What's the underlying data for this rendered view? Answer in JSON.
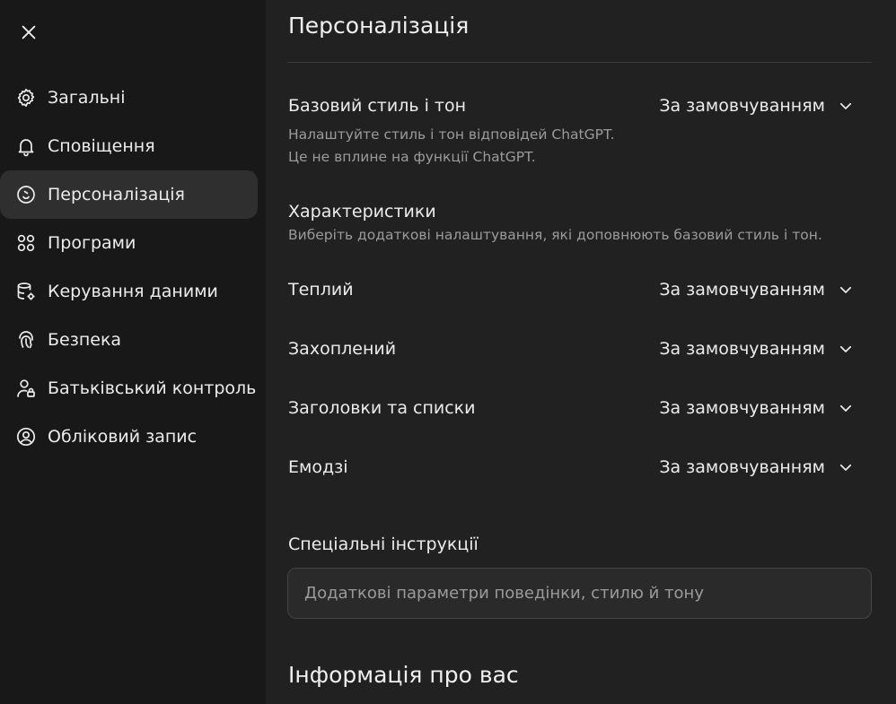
{
  "sidebar": {
    "items": [
      {
        "label": "Загальні",
        "icon": "gear-icon"
      },
      {
        "label": "Сповіщення",
        "icon": "bell-icon"
      },
      {
        "label": "Персоналізація",
        "icon": "personalization-icon",
        "active": true
      },
      {
        "label": "Програми",
        "icon": "apps-icon"
      },
      {
        "label": "Керування даними",
        "icon": "database-icon"
      },
      {
        "label": "Безпека",
        "icon": "fingerprint-icon"
      },
      {
        "label": "Батьківський контроль",
        "icon": "parental-control-icon"
      },
      {
        "label": "Обліковий запис",
        "icon": "user-circle-icon"
      }
    ]
  },
  "main": {
    "title": "Персоналізація",
    "base_style": {
      "label": "Базовий стиль і тон",
      "value": "За замовчуванням",
      "desc_line1": "Налаштуйте стиль і тон відповідей ChatGPT.",
      "desc_line2": "Це не вплине на функції ChatGPT."
    },
    "characteristics": {
      "label": "Характеристики",
      "desc": "Виберіть додаткові налаштування, які доповнюють базовий стиль і тон.",
      "items": [
        {
          "label": "Теплий",
          "value": "За замовчуванням"
        },
        {
          "label": "Захоплений",
          "value": "За замовчуванням"
        },
        {
          "label": "Заголовки та списки",
          "value": "За замовчуванням"
        },
        {
          "label": "Емодзі",
          "value": "За замовчуванням"
        }
      ]
    },
    "custom_instructions": {
      "label": "Спеціальні інструкції",
      "placeholder": "Додаткові параметри поведінки, стилю й тону",
      "value": ""
    },
    "about_you": {
      "title": "Інформація про вас"
    }
  },
  "colors": {
    "sidebar_bg": "#181818",
    "main_bg": "#212121",
    "active_item_bg": "#2f2f2f",
    "muted_text": "#9b9b9b"
  }
}
